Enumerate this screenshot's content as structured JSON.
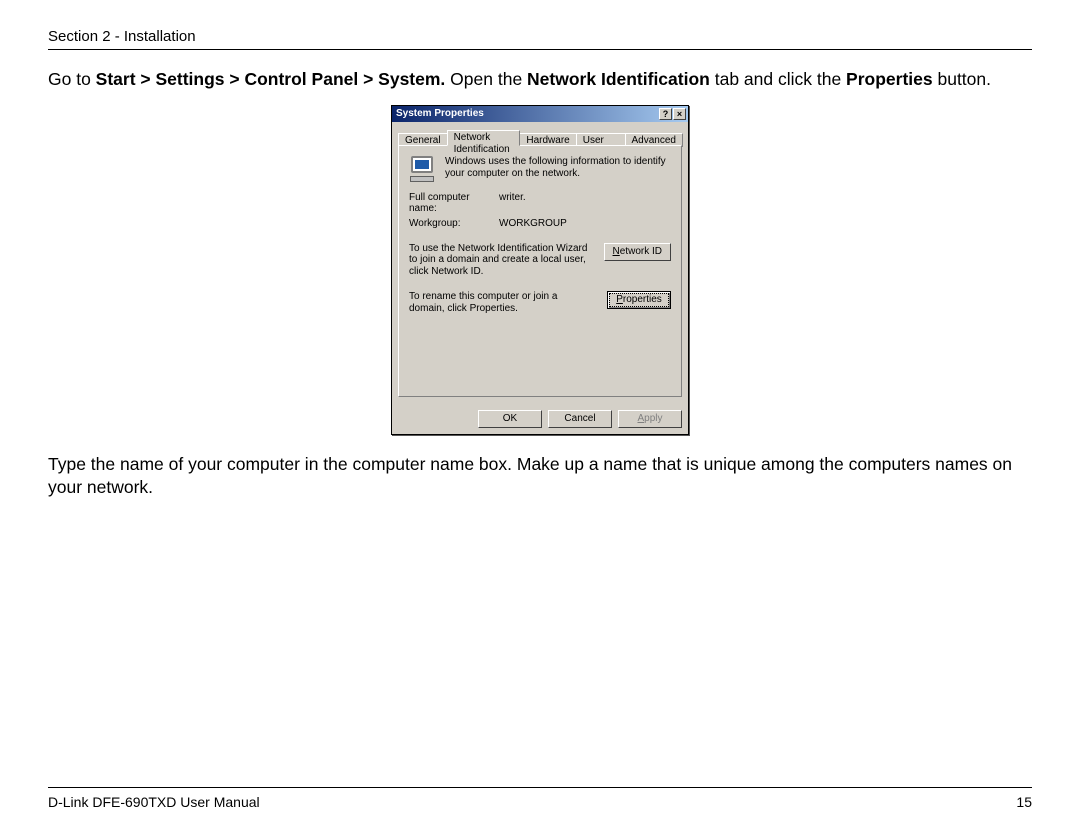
{
  "header": {
    "section": "Section 2 - Installation"
  },
  "intro": {
    "pre": "Go to ",
    "bold1": "Start > Settings > Control Panel > System.",
    "mid": " Open the ",
    "bold2": "Network Identification",
    "mid2": " tab and click the ",
    "bold3": "Properties",
    "post": " button."
  },
  "dialog": {
    "title": "System Properties",
    "help_btn": "?",
    "close_btn": "×",
    "tabs": {
      "general": "General",
      "netid": "Network Identification",
      "hardware": "Hardware",
      "userprofiles": "User Profiles",
      "advanced": "Advanced"
    },
    "info_text": "Windows uses the following information to identify your computer on the network.",
    "fullname_label": "Full computer name:",
    "fullname_value": "writer.",
    "workgroup_label": "Workgroup:",
    "workgroup_value": "WORKGROUP",
    "wizard_text": "To use the Network Identification Wizard to join a domain and create a local user, click Network ID.",
    "networkid_u": "N",
    "networkid_rest": "etwork ID",
    "rename_text": "To rename this computer or join a domain, click Properties.",
    "properties_u": "P",
    "properties_rest": "roperties",
    "ok": "OK",
    "cancel": "Cancel",
    "apply_u": "A",
    "apply_rest": "pply"
  },
  "para2": "Type the name of your computer in the computer name box. Make up a name that is unique among the computers names on your network.",
  "footer": {
    "manual": "D-Link DFE-690TXD User Manual",
    "page": "15"
  }
}
